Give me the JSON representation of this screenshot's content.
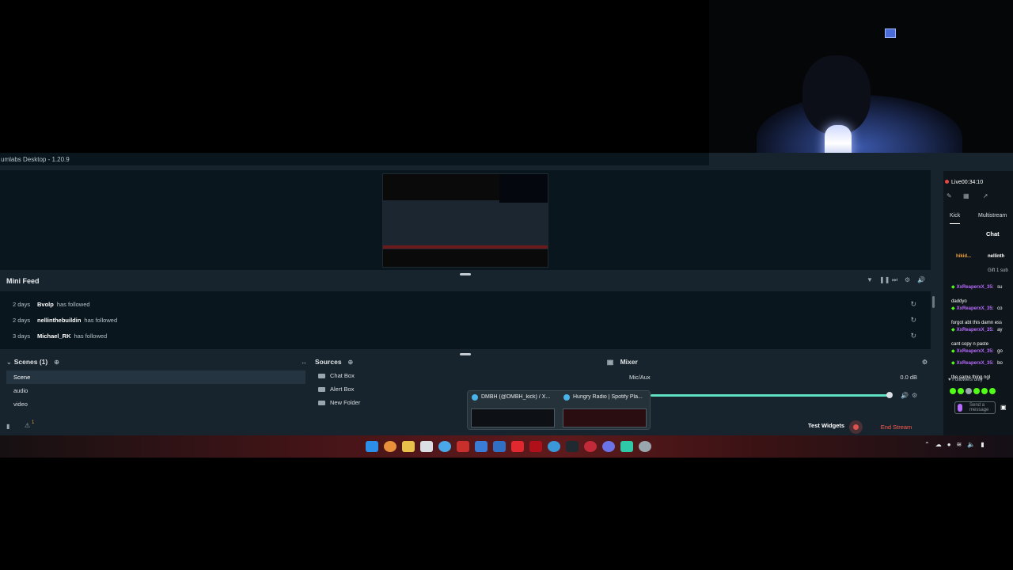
{
  "app": {
    "title": "umlabs Desktop - 1.20.9"
  },
  "mini_feed": {
    "title": "Mini Feed",
    "rows": [
      {
        "age": "2 days",
        "user": "Bvolp",
        "action": "has followed"
      },
      {
        "age": "2 days",
        "user": "nellinthebuildin",
        "action": "has followed"
      },
      {
        "age": "3 days",
        "user": "Michael_RK",
        "action": "has followed"
      }
    ]
  },
  "scenes": {
    "title": "Scenes (1)",
    "items": [
      "Scene",
      "audio",
      "video"
    ]
  },
  "sources": {
    "title": "Sources",
    "items": [
      "Chat Box",
      "Alert Box",
      "New Folder"
    ]
  },
  "mixer": {
    "title": "Mixer",
    "channel": "Mic/Aux",
    "level": "0.0 dB",
    "volume_fraction": 0.99
  },
  "footer": {
    "test_widgets": "Test Widgets",
    "end_stream": "End Stream",
    "alert_count": "1"
  },
  "thumbnails": [
    {
      "title": "DMBH (@DMBH_kick) / X..."
    },
    {
      "title": "Hungry Radio | Spotify Pla..."
    }
  ],
  "side_panel": {
    "live_label": "Live",
    "live_time": "00:34:10",
    "tab_kick": "Kick",
    "tab_multistream": "Multistream",
    "chat_title": "Chat",
    "pinned_user": "hikid...",
    "pinned_user2": "nellinth",
    "pinned_msg": "Gift 1 sub",
    "messages": [
      {
        "user": "XxReaperxX_35:",
        "text": "daddyo",
        "tail": "su"
      },
      {
        "user": "XxReaperxX_35:",
        "text": "forgot abt this damn ess",
        "tail": "co"
      },
      {
        "user": "XxReaperxX_35:",
        "text": "cant copy n paste",
        "tail": "ay"
      },
      {
        "user": "XxReaperxX_35:",
        "text": "",
        "tail": "go"
      },
      {
        "user": "XxReaperxX_35:",
        "text": "the same thing ngl",
        "tail": "bo"
      }
    ],
    "followers_only": "Followers only",
    "send_placeholder": "Send a message"
  },
  "colors": {
    "accent_teal": "#5ee0c1",
    "end_stream_red": "#ff5a4e",
    "kick_green": "#53fc18",
    "chat_user_purple": "#b86bff"
  }
}
